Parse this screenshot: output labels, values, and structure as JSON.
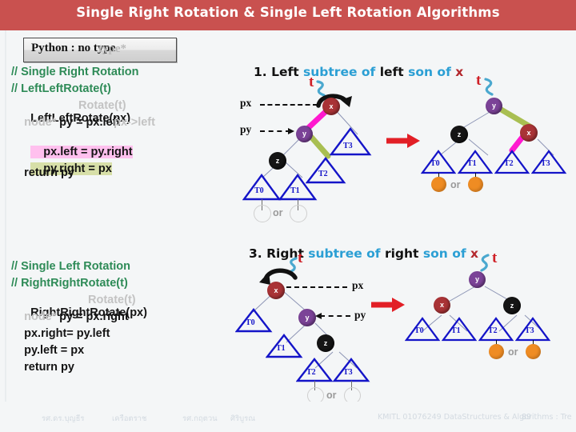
{
  "header": {
    "title": "Single Right Rotation & Single Left Rotation Algorithms",
    "bar_color": "#c9514f"
  },
  "badge": {
    "label": "Python : no type",
    "ghost": "type*"
  },
  "code_blocks": [
    {
      "id": "single-right-rotation",
      "lines": [
        {
          "text": "// Single Right Rotation",
          "style": "comment"
        },
        {
          "text": "// LeftLeftRotate(t)",
          "style": "comment"
        },
        {
          "text": "LeftLeftRotate(px)",
          "style": "code",
          "ghost_overlay": "Rotate(t)"
        },
        {
          "text": "    py = px.left",
          "style": "code",
          "ghost_prefix": "    node*",
          "ghost_suffix": "px->left"
        },
        {
          "text": "    px.left = py.right",
          "style": "code",
          "highlight": "pink"
        },
        {
          "text": "    py.right = px",
          "style": "code",
          "highlight": "olive"
        },
        {
          "text": "    return py",
          "style": "code"
        }
      ]
    },
    {
      "id": "single-left-rotation",
      "lines": [
        {
          "text": "// Single Left Rotation",
          "style": "comment"
        },
        {
          "text": "// RightRightRotate(t)",
          "style": "comment"
        },
        {
          "text": "RightRightRotate(px)",
          "style": "code",
          "ghost_overlay": "Rotate(t)"
        },
        {
          "text": "    py = px.right",
          "style": "code",
          "ghost_prefix": "    node*"
        },
        {
          "text": "    px.right= py.left",
          "style": "code"
        },
        {
          "text": "    py.left = px",
          "style": "code"
        },
        {
          "text": "    return py",
          "style": "code"
        }
      ]
    }
  ],
  "sections": [
    {
      "id": "section-1",
      "number": "1.",
      "w1": "Left",
      "w2": "subtree",
      "w3": "of",
      "w4": "left",
      "w5": "son",
      "w6": "of",
      "w7": "x"
    },
    {
      "id": "section-3",
      "number": "3.",
      "w1": "Right",
      "w2": "subtree",
      "w3": "of",
      "w4": "right",
      "w5": "son",
      "w6": "of",
      "w7": "x"
    }
  ],
  "labels": {
    "t": "t",
    "px": "px",
    "py": "py",
    "or": "or",
    "node_x": "x",
    "node_y": "y",
    "node_z": "z",
    "T0": "T0",
    "T1": "T1",
    "T2": "T2",
    "T3": "T3"
  },
  "footer": {
    "author1": "รศ.ดร.บุญธีร",
    "author2": "เครือตราช",
    "author3": "รศ.กฤตวน",
    "author4": "ศิริบูรณ",
    "course": "KMITL 01076249 DataStructures & Algorithms : Tre",
    "page": "89"
  },
  "colors": {
    "node_x": "#a93336",
    "node_y": "#7b4397",
    "node_z": "#151515",
    "triangle": "#1414c8",
    "pink_edge": "#ff19cf",
    "olive_edge": "#a9bf52",
    "bubble": "#ef8c23",
    "arrow_red": "#e21f26",
    "accent_blue": "#2b9fd4",
    "comment_green": "#2e8b57",
    "highlight_pink": "#ffc0ee",
    "highlight_olive": "#d7dfa8"
  }
}
